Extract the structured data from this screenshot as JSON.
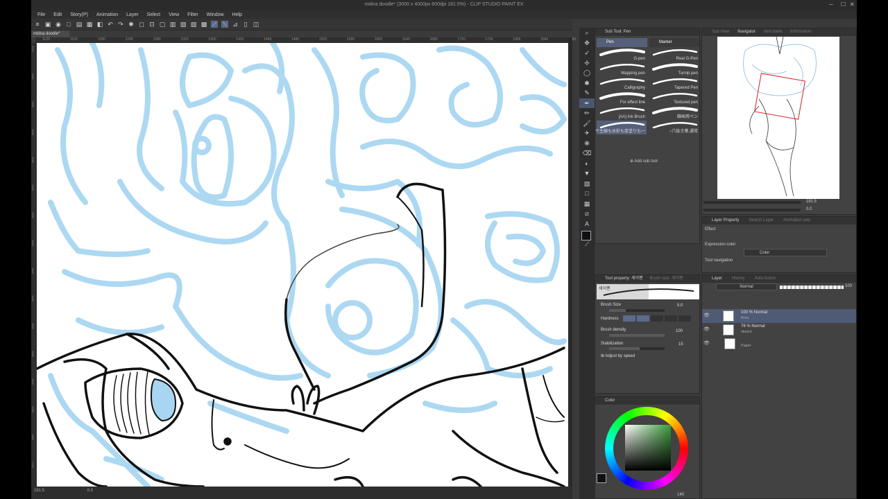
{
  "window": {
    "title": "midna doodle* (3000 x 4000px 600dpi 181.5%) - CLIP STUDIO PAINT EX",
    "controls": [
      "─",
      "☐",
      "✕"
    ]
  },
  "menu": [
    "File",
    "Edit",
    "Story(P)",
    "Animation",
    "Layer",
    "Select",
    "View",
    "Filter",
    "Window",
    "Help"
  ],
  "document_tab": "midna doodle*",
  "ruler": {
    "top_ticks": [
      "1120",
      "1160",
      "1200",
      "1240",
      "1280",
      "1320",
      "1360",
      "1400",
      "1440",
      "1480",
      "1520",
      "1560",
      "1600",
      "1640",
      "1680",
      "1720",
      "1760",
      "1800",
      "1840",
      "1880",
      "1920",
      "1960",
      "200"
    ],
    "left_ticks": [
      "1120",
      "1160",
      "1200",
      "1240",
      "1280",
      "1320",
      "1360",
      "1400",
      "1440",
      "1480",
      "1520",
      "1560",
      "1600",
      "1640",
      "1680",
      "1720"
    ]
  },
  "status": {
    "zoom": "181.5",
    "angle": "0.0"
  },
  "sub_tool": {
    "tab_label": "Sub Tool: Pen",
    "categories": [
      "Pen",
      "Marker"
    ],
    "brushes": [
      {
        "label": "G-pen"
      },
      {
        "label": "Real G-Pen"
      },
      {
        "label": "Mapping pen"
      },
      {
        "label": "Turnip pen"
      },
      {
        "label": "Calligraphy"
      },
      {
        "label": "Tapered Pen"
      },
      {
        "label": "For effect line"
      },
      {
        "label": "Textured pen"
      },
      {
        "label": "[AA] Ink Brush"
      },
      {
        "label": "線画用ペン"
      },
      {
        "label": "サ4サ主線も水彩も厚塗りも一"
      },
      {
        "label": "○穴抜き葉,通常"
      }
    ],
    "add_label": "Add sub tool"
  },
  "tool_property": {
    "tab_label": "Tool property: 세이펜",
    "tab2_label": "Brush size: 세이펜",
    "preset_name": "세이펜",
    "brush_size_label": "Brush Size",
    "brush_size_value": "5.0",
    "hardness_label": "Hardness",
    "brush_density_label": "Brush density",
    "brush_density_value": "100",
    "stabilization_label": "Stabilization",
    "stabilization_value": "15",
    "adjust_label": "Adjust by speed",
    "brush_size_fraction": 0.3,
    "brush_density_fraction": 1.0,
    "stabilization_fraction": 0.55
  },
  "color_panel": {
    "tab_label": "Color",
    "main_color": "#0f0f14",
    "sub_color": "#ffffff",
    "readout": "140"
  },
  "navigator": {
    "tabs": [
      "Sub View",
      "Navigator",
      "Item bank",
      "Information"
    ],
    "zoom": "181.5",
    "angle": "0.0"
  },
  "layer_property": {
    "tabs": [
      "Layer Property",
      "Search Layer",
      "Animation cels"
    ],
    "effect_label": "Effect",
    "expression_label": "Expression color",
    "expression_value": "Color",
    "tool_nav_label": "Tool navigation"
  },
  "layers_panel": {
    "tabs": [
      "Layer",
      "History",
      "Auto Action"
    ],
    "blend_mode": "Normal",
    "opacity": "100",
    "layers": [
      {
        "line1": "100 % Normal",
        "line2": "lines",
        "selected": true
      },
      {
        "line1": "76 % Normal",
        "line2": "sketch",
        "selected": false
      },
      {
        "line1": "",
        "line2": "Paper",
        "selected": false
      }
    ]
  },
  "icons": {
    "tools": [
      "zoom-icon",
      "move-icon",
      "operation-icon",
      "move-layer-icon",
      "lasso-icon",
      "magic-wand-icon",
      "eyedropper-icon",
      "pen-icon",
      "pencil-icon",
      "brush-icon",
      "airbrush-icon",
      "decoration-icon",
      "eraser-icon",
      "blend-icon",
      "fill-icon",
      "gradient-icon",
      "figure-icon",
      "frame-icon",
      "ruler-icon",
      "text-icon",
      "balloon-icon",
      "correct-line-icon"
    ]
  }
}
